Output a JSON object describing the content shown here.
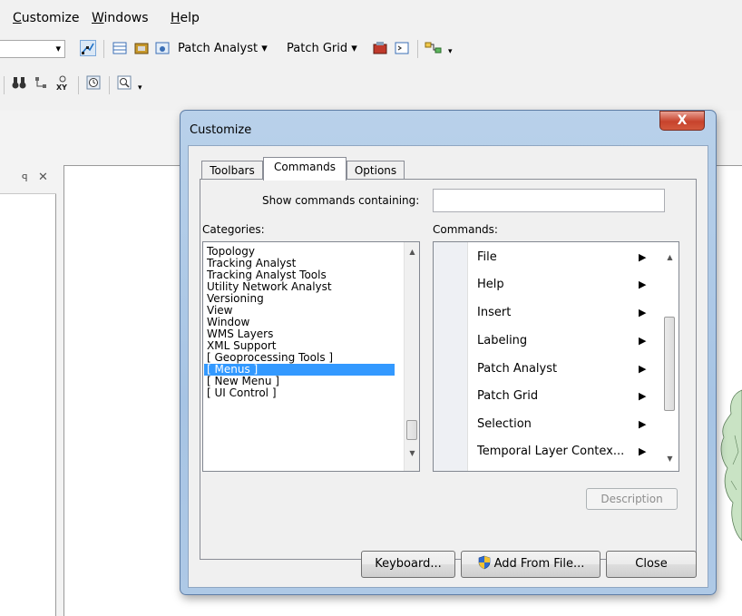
{
  "menubar": {
    "items": [
      {
        "label": "Customize",
        "accel": "C",
        "rest": "ustomize"
      },
      {
        "label": "Windows",
        "accel": "W",
        "rest": "indows"
      },
      {
        "label": "Help",
        "accel": "H",
        "rest": "elp"
      }
    ]
  },
  "toolbar1": {
    "patch_analyst_label": "Patch Analyst",
    "patch_grid_label": "Patch Grid",
    "dropdown_glyph": "▾"
  },
  "panel": {
    "pin_glyph": "ꟼ",
    "close_glyph": "✕"
  },
  "dialog": {
    "title": "Customize",
    "close_glyph": "X",
    "tabs": [
      {
        "label": "Toolbars",
        "active": false
      },
      {
        "label": "Commands",
        "active": true
      },
      {
        "label": "Options",
        "active": false
      }
    ],
    "show_commands_label": "Show commands containing:",
    "search_value": "",
    "categories_label": "Categories:",
    "commands_label": "Commands:",
    "categories": [
      "Topology",
      "Tracking Analyst",
      "Tracking Analyst Tools",
      "Utility Network Analyst",
      "Versioning",
      "View",
      "Window",
      "WMS Layers",
      "XML Support",
      "[ Geoprocessing Tools ]",
      "[ Menus ]",
      "[ New Menu ]",
      "[ UI Control ]"
    ],
    "selected_category": "[ Menus ]",
    "commands": [
      "File",
      "Help",
      "Insert",
      "Labeling",
      "Patch Analyst",
      "Patch Grid",
      "Selection",
      "Temporal Layer Contex..."
    ],
    "submenu_arrow": "▶",
    "scroll_up": "▲",
    "scroll_down": "▼",
    "description_label": "Description",
    "keyboard_label": "Keyboard...",
    "add_from_file_label": "Add From File...",
    "close_label": "Close"
  },
  "colors": {
    "selection": "#3399ff",
    "title_bar": "#b9d1ea",
    "close_button": "#c7432c"
  }
}
